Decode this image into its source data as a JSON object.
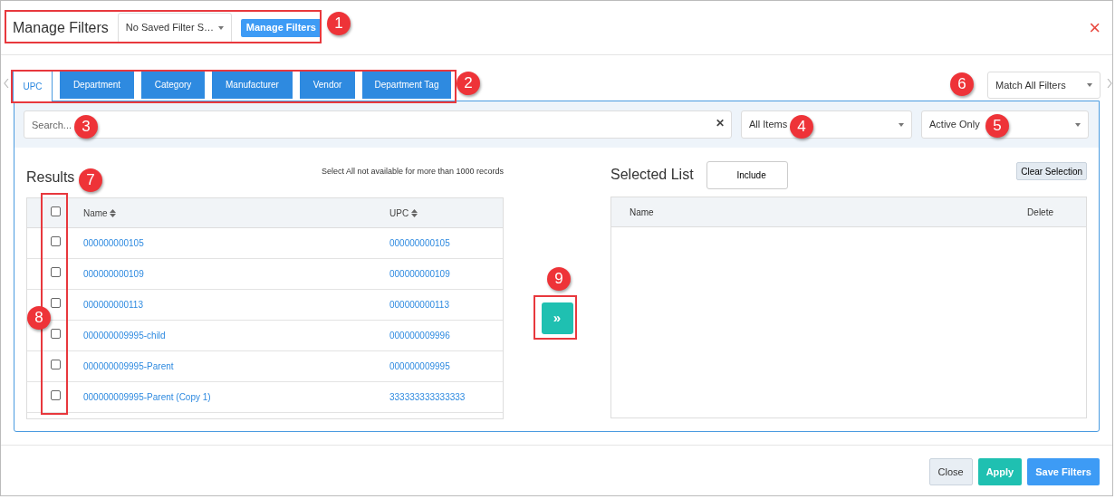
{
  "header": {
    "title": "Manage Filters",
    "saved_filter": "No Saved Filter S…",
    "manage_button": "Manage Filters",
    "close": "×"
  },
  "tabs": [
    {
      "label": "UPC",
      "selected": true
    },
    {
      "label": "Department",
      "selected": false
    },
    {
      "label": "Category",
      "selected": false
    },
    {
      "label": "Manufacturer",
      "selected": false
    },
    {
      "label": "Vendor",
      "selected": false
    },
    {
      "label": "Department Tag",
      "selected": false
    }
  ],
  "match_select": "Match All Filters",
  "search": {
    "placeholder": "Search...",
    "clear": "✕"
  },
  "item_select": "All Items",
  "status_select": "Active Only",
  "results": {
    "title": "Results",
    "note": "Select All not available for more than 1000 records",
    "columns": [
      "Name",
      "UPC"
    ],
    "select_all_checked": false,
    "rows": [
      {
        "name": "000000000105",
        "upc": "000000000105",
        "checked": false
      },
      {
        "name": "000000000109",
        "upc": "000000000109",
        "checked": false
      },
      {
        "name": "000000000113",
        "upc": "000000000113",
        "checked": false
      },
      {
        "name": "000000009995-child",
        "upc": "000000009996",
        "checked": false
      },
      {
        "name": "000000009995-Parent",
        "upc": "000000009995",
        "checked": false
      },
      {
        "name": "000000009995-Parent (Copy 1)",
        "upc": "333333333333333",
        "checked": false
      }
    ]
  },
  "move_button": "»",
  "selected_list": {
    "title": "Selected List",
    "toggle_label": "Include",
    "clear_button": "Clear Selection",
    "columns": [
      "Name",
      "Delete"
    ]
  },
  "footer": {
    "buttons": [
      {
        "label": "Close",
        "kind": "secondary"
      },
      {
        "label": "Apply",
        "kind": "success"
      },
      {
        "label": "Save Filters",
        "kind": "primary"
      }
    ]
  },
  "callouts": [
    {
      "number": "1"
    },
    {
      "number": "2"
    },
    {
      "number": "3"
    },
    {
      "number": "4"
    },
    {
      "number": "5"
    },
    {
      "number": "6"
    },
    {
      "number": "7"
    },
    {
      "number": "8"
    },
    {
      "number": "9"
    }
  ]
}
